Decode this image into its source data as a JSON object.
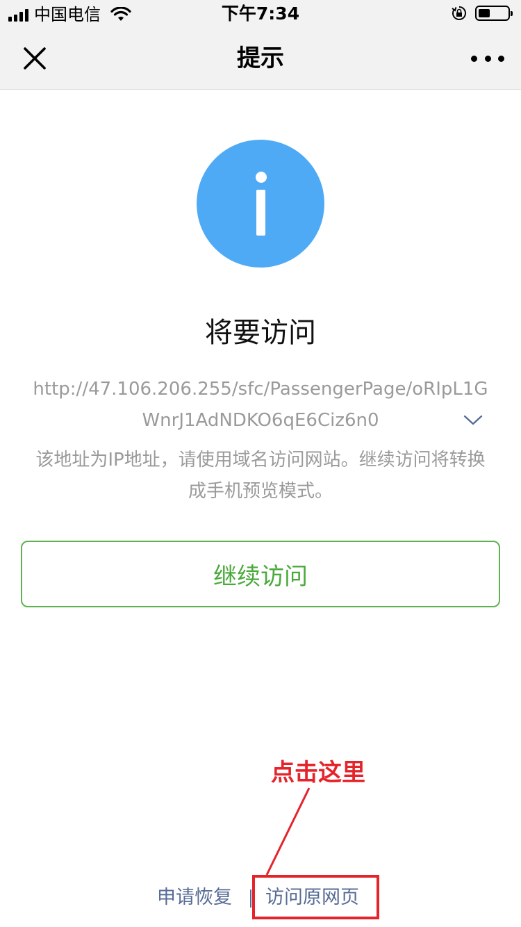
{
  "status_bar": {
    "carrier": "中国电信",
    "time": "下午7:34",
    "battery_level": 0.4
  },
  "nav": {
    "title": "提示",
    "close_icon": "close-icon",
    "more_icon": "more-icon"
  },
  "main": {
    "icon": "info-icon",
    "icon_color": "#4faaf5",
    "heading": "将要访问",
    "url": "http://47.106.206.255/sfc/PassengerPage/oRIpL1GWnrJ1AdNDKO6qE6Ciz6n0",
    "notice": "该地址为IP地址，请使用域名访问网站。继续访问将转换成手机预览模式。",
    "continue_label": "继续访问",
    "accent_color": "#4aa93a"
  },
  "annotation": {
    "label": "点击这里",
    "color": "#e5232b"
  },
  "footer": {
    "restore_label": "申请恢复",
    "visit_original_label": "访问原网页",
    "link_color": "#576b95"
  }
}
